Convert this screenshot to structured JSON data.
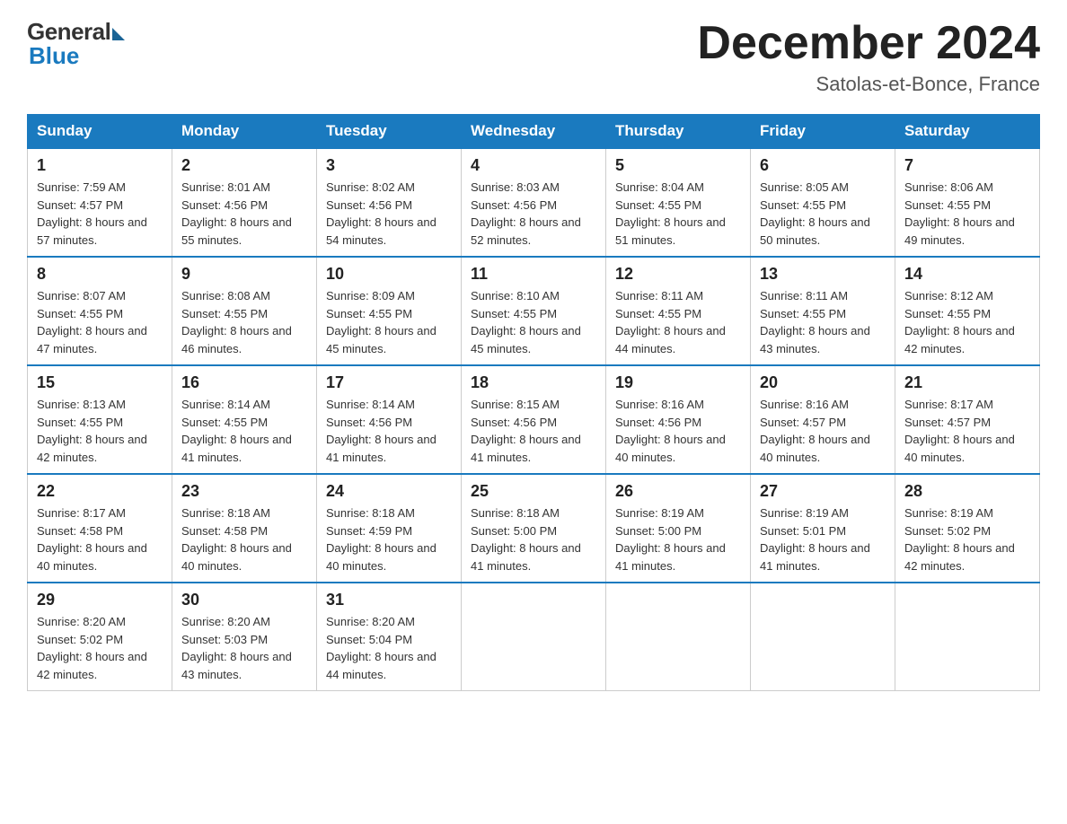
{
  "logo": {
    "general": "General",
    "blue": "Blue"
  },
  "title": "December 2024",
  "location": "Satolas-et-Bonce, France",
  "headers": [
    "Sunday",
    "Monday",
    "Tuesday",
    "Wednesday",
    "Thursday",
    "Friday",
    "Saturday"
  ],
  "weeks": [
    [
      {
        "day": "1",
        "sunrise": "7:59 AM",
        "sunset": "4:57 PM",
        "daylight": "8 hours and 57 minutes."
      },
      {
        "day": "2",
        "sunrise": "8:01 AM",
        "sunset": "4:56 PM",
        "daylight": "8 hours and 55 minutes."
      },
      {
        "day": "3",
        "sunrise": "8:02 AM",
        "sunset": "4:56 PM",
        "daylight": "8 hours and 54 minutes."
      },
      {
        "day": "4",
        "sunrise": "8:03 AM",
        "sunset": "4:56 PM",
        "daylight": "8 hours and 52 minutes."
      },
      {
        "day": "5",
        "sunrise": "8:04 AM",
        "sunset": "4:55 PM",
        "daylight": "8 hours and 51 minutes."
      },
      {
        "day": "6",
        "sunrise": "8:05 AM",
        "sunset": "4:55 PM",
        "daylight": "8 hours and 50 minutes."
      },
      {
        "day": "7",
        "sunrise": "8:06 AM",
        "sunset": "4:55 PM",
        "daylight": "8 hours and 49 minutes."
      }
    ],
    [
      {
        "day": "8",
        "sunrise": "8:07 AM",
        "sunset": "4:55 PM",
        "daylight": "8 hours and 47 minutes."
      },
      {
        "day": "9",
        "sunrise": "8:08 AM",
        "sunset": "4:55 PM",
        "daylight": "8 hours and 46 minutes."
      },
      {
        "day": "10",
        "sunrise": "8:09 AM",
        "sunset": "4:55 PM",
        "daylight": "8 hours and 45 minutes."
      },
      {
        "day": "11",
        "sunrise": "8:10 AM",
        "sunset": "4:55 PM",
        "daylight": "8 hours and 45 minutes."
      },
      {
        "day": "12",
        "sunrise": "8:11 AM",
        "sunset": "4:55 PM",
        "daylight": "8 hours and 44 minutes."
      },
      {
        "day": "13",
        "sunrise": "8:11 AM",
        "sunset": "4:55 PM",
        "daylight": "8 hours and 43 minutes."
      },
      {
        "day": "14",
        "sunrise": "8:12 AM",
        "sunset": "4:55 PM",
        "daylight": "8 hours and 42 minutes."
      }
    ],
    [
      {
        "day": "15",
        "sunrise": "8:13 AM",
        "sunset": "4:55 PM",
        "daylight": "8 hours and 42 minutes."
      },
      {
        "day": "16",
        "sunrise": "8:14 AM",
        "sunset": "4:55 PM",
        "daylight": "8 hours and 41 minutes."
      },
      {
        "day": "17",
        "sunrise": "8:14 AM",
        "sunset": "4:56 PM",
        "daylight": "8 hours and 41 minutes."
      },
      {
        "day": "18",
        "sunrise": "8:15 AM",
        "sunset": "4:56 PM",
        "daylight": "8 hours and 41 minutes."
      },
      {
        "day": "19",
        "sunrise": "8:16 AM",
        "sunset": "4:56 PM",
        "daylight": "8 hours and 40 minutes."
      },
      {
        "day": "20",
        "sunrise": "8:16 AM",
        "sunset": "4:57 PM",
        "daylight": "8 hours and 40 minutes."
      },
      {
        "day": "21",
        "sunrise": "8:17 AM",
        "sunset": "4:57 PM",
        "daylight": "8 hours and 40 minutes."
      }
    ],
    [
      {
        "day": "22",
        "sunrise": "8:17 AM",
        "sunset": "4:58 PM",
        "daylight": "8 hours and 40 minutes."
      },
      {
        "day": "23",
        "sunrise": "8:18 AM",
        "sunset": "4:58 PM",
        "daylight": "8 hours and 40 minutes."
      },
      {
        "day": "24",
        "sunrise": "8:18 AM",
        "sunset": "4:59 PM",
        "daylight": "8 hours and 40 minutes."
      },
      {
        "day": "25",
        "sunrise": "8:18 AM",
        "sunset": "5:00 PM",
        "daylight": "8 hours and 41 minutes."
      },
      {
        "day": "26",
        "sunrise": "8:19 AM",
        "sunset": "5:00 PM",
        "daylight": "8 hours and 41 minutes."
      },
      {
        "day": "27",
        "sunrise": "8:19 AM",
        "sunset": "5:01 PM",
        "daylight": "8 hours and 41 minutes."
      },
      {
        "day": "28",
        "sunrise": "8:19 AM",
        "sunset": "5:02 PM",
        "daylight": "8 hours and 42 minutes."
      }
    ],
    [
      {
        "day": "29",
        "sunrise": "8:20 AM",
        "sunset": "5:02 PM",
        "daylight": "8 hours and 42 minutes."
      },
      {
        "day": "30",
        "sunrise": "8:20 AM",
        "sunset": "5:03 PM",
        "daylight": "8 hours and 43 minutes."
      },
      {
        "day": "31",
        "sunrise": "8:20 AM",
        "sunset": "5:04 PM",
        "daylight": "8 hours and 44 minutes."
      },
      null,
      null,
      null,
      null
    ]
  ],
  "labels": {
    "sunrise": "Sunrise: ",
    "sunset": "Sunset: ",
    "daylight": "Daylight: "
  }
}
